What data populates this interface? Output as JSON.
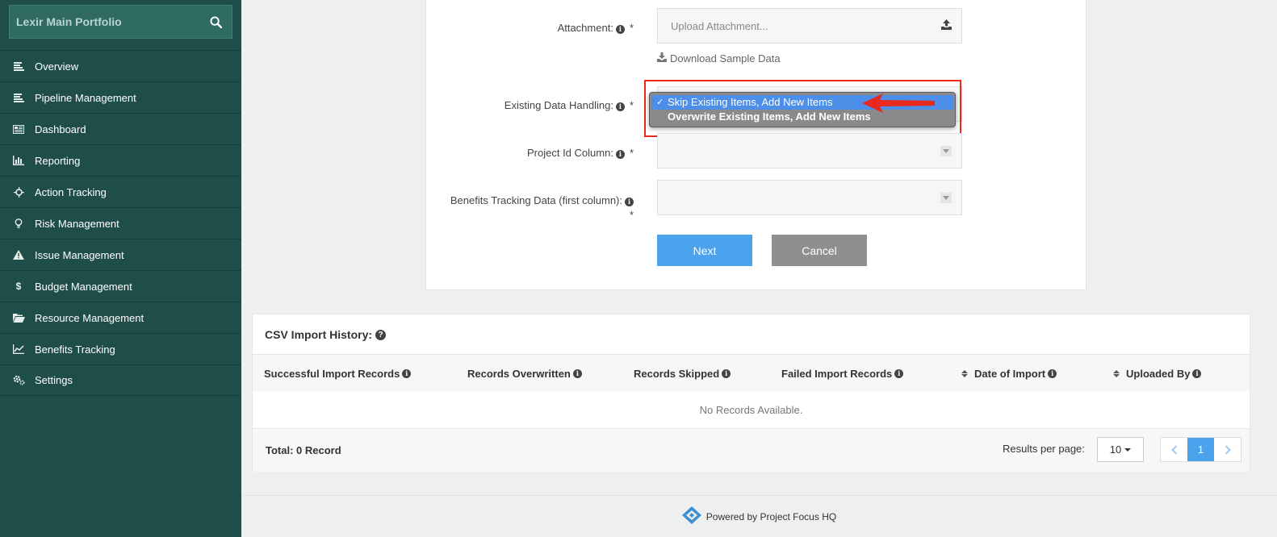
{
  "sidebar": {
    "portfolio_name": "Lexir Main Portfolio",
    "items": [
      {
        "label": "Overview",
        "icon": "list-icon"
      },
      {
        "label": "Pipeline Management",
        "icon": "list-icon"
      },
      {
        "label": "Dashboard",
        "icon": "dashboard-icon"
      },
      {
        "label": "Reporting",
        "icon": "bar-chart-icon"
      },
      {
        "label": "Action Tracking",
        "icon": "crosshair-icon"
      },
      {
        "label": "Risk Management",
        "icon": "lightbulb-icon"
      },
      {
        "label": "Issue Management",
        "icon": "warning-icon"
      },
      {
        "label": "Budget Management",
        "icon": "dollar-icon"
      },
      {
        "label": "Resource Management",
        "icon": "folder-open-icon"
      },
      {
        "label": "Benefits Tracking",
        "icon": "line-chart-icon"
      },
      {
        "label": "Settings",
        "icon": "cogs-icon"
      }
    ]
  },
  "form": {
    "attachment_label": "Attachment:",
    "upload_placeholder": "Upload Attachment...",
    "download_sample": "Download Sample Data",
    "existing_label": "Existing Data Handling:",
    "existing_options": [
      "Skip Existing Items, Add New Items",
      "Overwrite Existing Items, Add New Items"
    ],
    "existing_selected": "Skip Existing Items, Add New Items",
    "project_id_label": "Project Id Column:",
    "benefits_label": "Benefits Tracking Data (first column):",
    "required_mark": "*",
    "next_label": "Next",
    "cancel_label": "Cancel"
  },
  "history": {
    "title": "CSV Import History:",
    "columns": [
      "Successful Import Records",
      "Records Overwritten",
      "Records Skipped",
      "Failed Import Records",
      "Date of Import",
      "Uploaded By"
    ],
    "empty_message": "No Records Available.",
    "total": "Total: 0 Record",
    "results_per_page_label": "Results per page:",
    "results_per_page": "10",
    "current_page": "1"
  },
  "footer": {
    "text": "Powered by Project Focus HQ"
  },
  "colors": {
    "sidebar_bg": "#1f4e4a",
    "primary": "#4aa3ec",
    "highlight": "#e8291c"
  }
}
